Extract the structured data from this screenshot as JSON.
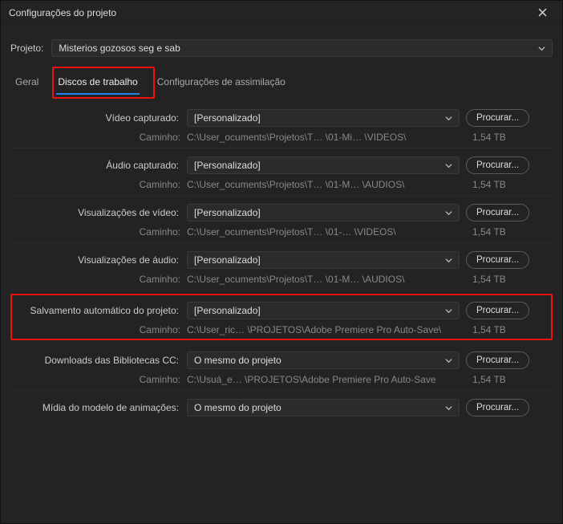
{
  "window": {
    "title": "Configurações do projeto"
  },
  "project": {
    "label": "Projeto:",
    "value": "Misterios gozosos seg e sab"
  },
  "tabs": {
    "geral": "Geral",
    "discos": "Discos de trabalho",
    "assim": "Configurações de assimilação"
  },
  "labels": {
    "browse": "Procurar...",
    "path": "Caminho:"
  },
  "sections": [
    {
      "label": "Vídeo capturado:",
      "value": "[Personalizado]",
      "path": "C:\\User_ocuments\\Projetos\\T…  \\01-Mi…                          \\VIDEOS\\",
      "size": "1,54 TB"
    },
    {
      "label": "Áudio capturado:",
      "value": "[Personalizado]",
      "path": "C:\\User_ocuments\\Projetos\\T…  \\01-M…                           \\AUDIOS\\",
      "size": "1,54 TB"
    },
    {
      "label": "Visualizações de vídeo:",
      "value": "[Personalizado]",
      "path": "C:\\User_ocuments\\Projetos\\T…  \\01-…                            \\VIDEOS\\",
      "size": "1,54 TB"
    },
    {
      "label": "Visualizações de áudio:",
      "value": "[Personalizado]",
      "path": "C:\\User_ocuments\\Projetos\\T…  \\01-M…                           \\AUDIOS\\",
      "size": "1,54 TB"
    },
    {
      "label": "Salvamento automático do projeto:",
      "value": "[Personalizado]",
      "path": "C:\\User_ric…                   \\PROJETOS\\Adobe Premiere Pro Auto-Save\\",
      "size": "1,54 TB"
    },
    {
      "label": "Downloads das Bibliotecas CC:",
      "value": "O mesmo do projeto",
      "path": "C:\\Usuá_e…                     \\PROJETOS\\Adobe Premiere Pro Auto-Save",
      "size": "1,54 TB"
    },
    {
      "label": "Mídia do modelo de animações:",
      "value": "O mesmo do projeto",
      "path": "",
      "size": ""
    }
  ]
}
